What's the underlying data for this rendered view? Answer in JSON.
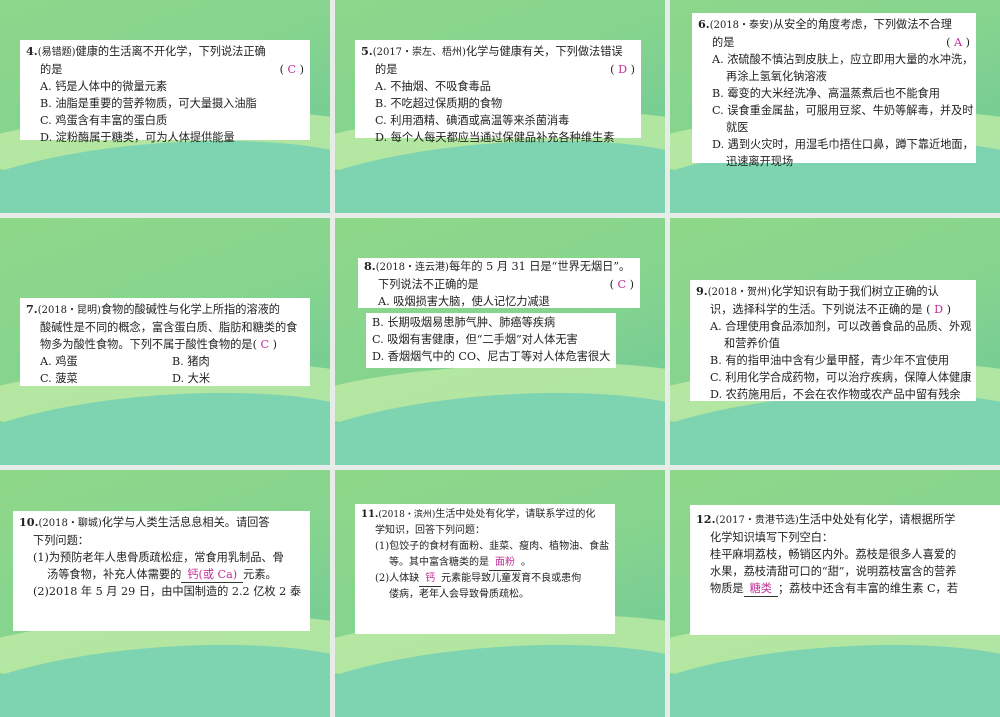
{
  "slides": [
    {
      "num": "4.",
      "src": "(易错题)",
      "stem1": "健康的生活离不开化学，下列说法正确",
      "stem2": "的是",
      "answer": "C",
      "options": [
        "A. 钙是人体中的微量元素",
        "B. 油脂是重要的营养物质，可大量摄入油脂",
        "C. 鸡蛋含有丰富的蛋白质",
        "D. 淀粉酶属于糖类，可为人体提供能量"
      ]
    },
    {
      "num": "5.",
      "src": "(2017・崇左、梧州)",
      "stem1": "化学与健康有关，下列做法错误",
      "stem2": "的是",
      "answer": "D",
      "options": [
        "A. 不抽烟、不吸食毒品",
        "B. 不吃超过保质期的食物",
        "C. 利用酒精、碘酒或高温等来杀菌消毒",
        "D. 每个人每天都应当通过保健品补充各种维生素"
      ]
    },
    {
      "num": "6.",
      "src": "(2018・泰安)",
      "stem1": "从安全的角度考虑，下列做法不合理",
      "stem2": "的是",
      "answer": "A",
      "options": [
        "A. 浓硫酸不慎沾到皮肤上，应立即用大量的水冲洗，",
        "再涂上氢氧化钠溶液",
        "B. 霉变的大米经洗净、高温蒸煮后也不能食用",
        "C. 误食重金属盐，可服用豆浆、牛奶等解毒，并及时",
        "就医",
        "D. 遇到火灾时，用湿毛巾捂住口鼻，蹲下靠近地面，",
        "迅速离开现场"
      ]
    },
    {
      "num": "7.",
      "src": "(2018・昆明)",
      "stem1": "食物的酸碱性与化学上所指的溶液的",
      "stem2": "酸碱性是不同的概念，富含蛋白质、脂肪和糖类的食",
      "stem3": "物多为酸性食物。下列不属于酸性食物的是",
      "answer": "C",
      "options": [
        "A. 鸡蛋",
        "B. 猪肉",
        "C. 菠菜",
        "D. 大米"
      ]
    },
    {
      "num": "8.",
      "src": "(2018・连云港)",
      "stem1": "每年的 5 月 31 日是“世界无烟日”。",
      "stem2": "下列说法不正确的是",
      "answer": "C",
      "options": [
        "A. 吸烟损害大脑，使人记忆力减退",
        "B. 长期吸烟易患肺气肿、肺癌等疾病",
        "C. 吸烟有害健康，但“二手烟”对人体无害",
        "D. 香烟烟气中的 CO、尼古丁等对人体危害很大"
      ]
    },
    {
      "num": "9.",
      "src": "(2018・贺州)",
      "stem1": "化学知识有助于我们树立正确的认",
      "stem2": "识，选择科学的生活。下列说法不正确的是",
      "answer": "D",
      "options": [
        "A. 合理使用食品添加剂，可以改善食品的品质、外观",
        "和营养价值",
        "B. 有的指甲油中含有少量甲醛，青少年不宜使用",
        "C. 利用化学合成药物，可以治疗疾病，保障人体健康",
        "D. 农药施用后，不会在农作物或农产品中留有残余"
      ]
    },
    {
      "num": "10.",
      "src": "(2018・聊城)",
      "stem1": "化学与人类生活息息相关。请回答",
      "stem2": "下列问题：",
      "q1a": "(1)为预防老年人患骨质疏松症，常食用乳制品、骨",
      "q1b": "汤等食物，补充人体需要的",
      "q1_blank": "钙(或 Ca)",
      "q1c": "元素。",
      "q2a": "(2)2018 年 5 月 29 日，由中国制造的 2.2 亿枚 2 泰"
    },
    {
      "num": "11.",
      "src": "(2018・滨州)",
      "stem1": "生活中处处有化学，请联系学过的化",
      "stem2": "学知识，回答下列问题：",
      "q1a": "(1)包饺子的食材有面粉、韭菜、瘦肉、植物油、食盐",
      "q1b": "等。其中富含糖类的是",
      "q1_blank": "面粉",
      "q1c": "。",
      "q2a": "(2)人体缺",
      "q2_blank": "钙",
      "q2b": "元素能导致儿童发育不良或患佝",
      "q2c": "偻病，老年人会导致骨质疏松。"
    },
    {
      "num": "12.",
      "src": "(2017・贵港节选)",
      "stem1": "生活中处处有化学，请根据所学",
      "stem2": "化学知识填写下列空白：",
      "p1": "桂平麻垌荔枝，畅销区内外。荔枝是很多人喜爱的",
      "p2": "水果，荔枝清甜可口的“甜”，说明荔枝富含的营养",
      "p3a": "物质是",
      "p3_blank": "糖类",
      "p3b": "；荔枝中还含有丰富的维生素 C，若"
    }
  ]
}
